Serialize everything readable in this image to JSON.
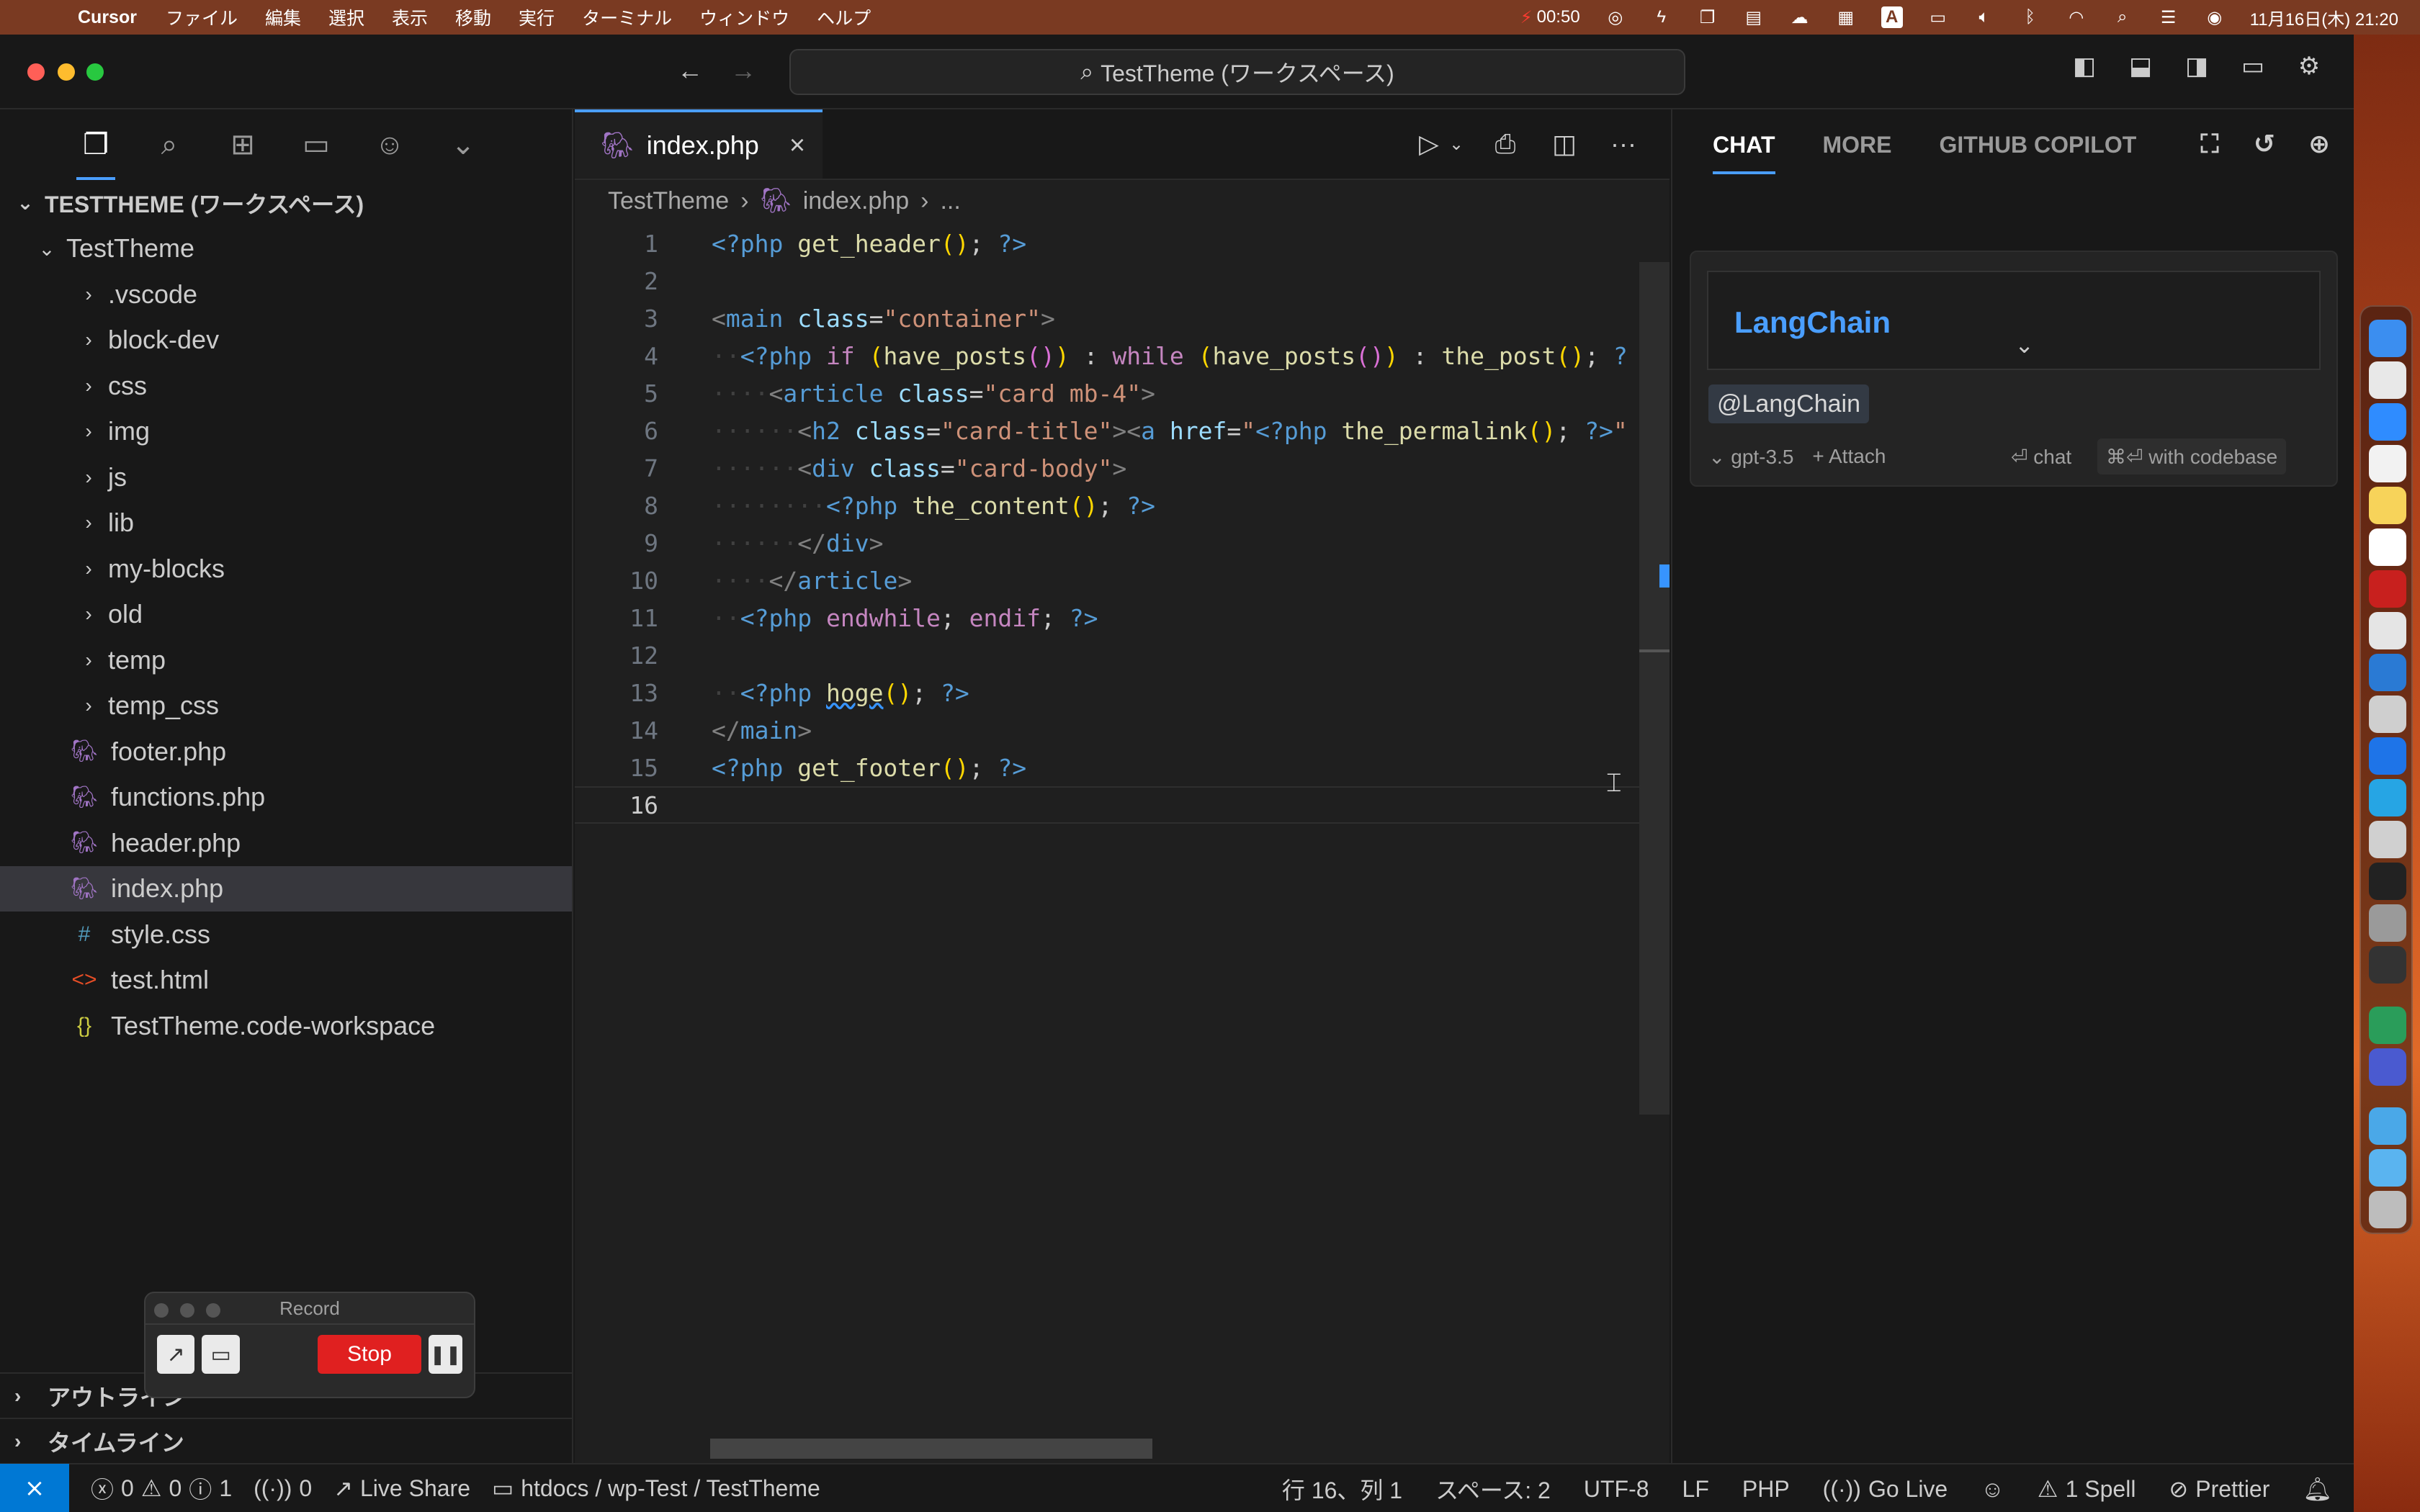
{
  "menubar": {
    "app": "Cursor",
    "items": [
      "ファイル",
      "編集",
      "選択",
      "表示",
      "移動",
      "実行",
      "ターミナル",
      "ウィンドウ",
      "ヘルプ"
    ],
    "rec_time": "00:50",
    "datetime": "11月16日(木) 21:20"
  },
  "titlebar": {
    "search": "TestTheme (ワークスペース)"
  },
  "explorer": {
    "workspace": "TESTTHEME (ワークスペース)",
    "root": "TestTheme",
    "folders": [
      ".vscode",
      "block-dev",
      "css",
      "img",
      "js",
      "lib",
      "my-blocks",
      "old",
      "temp",
      "temp_css"
    ],
    "files": [
      {
        "name": "footer.php",
        "icon": "php-elephant-icon"
      },
      {
        "name": "functions.php",
        "icon": "php-elephant-icon"
      },
      {
        "name": "header.php",
        "icon": "php-elephant-icon"
      },
      {
        "name": "index.php",
        "icon": "php-elephant-icon"
      },
      {
        "name": "style.css",
        "icon": "hash-icon"
      },
      {
        "name": "test.html",
        "icon": "html-brackets-icon"
      },
      {
        "name": "TestTheme.code-workspace",
        "icon": "json-braces-icon"
      }
    ],
    "outline": "アウトライン",
    "timeline": "タイムライン"
  },
  "record": {
    "title": "Record",
    "stop": "Stop"
  },
  "editor": {
    "tab": "index.php",
    "breadcrumb": [
      "TestTheme",
      "index.php",
      "..."
    ],
    "current_line": 16
  },
  "chat": {
    "tabs": [
      "CHAT",
      "MORE",
      "GITHUB COPILOT"
    ],
    "input_value": "LangChain",
    "mention": "@LangChain",
    "model": "gpt-3.5",
    "attach": "+ Attach",
    "chat_btn": "⏎ chat",
    "codebase_btn": "⌘⏎ with codebase"
  },
  "status": {
    "problems_errors": "0",
    "problems_warnings": "0",
    "problems_info": "1",
    "ports": "0",
    "live_share": "Live Share",
    "path": "htdocs / wp-Test / TestTheme",
    "position": "行 16、列 1",
    "spaces": "スペース: 2",
    "encoding": "UTF-8",
    "eol": "LF",
    "language": "PHP",
    "go_live": "Go Live",
    "spell": "1 Spell",
    "prettier": "Prettier"
  }
}
